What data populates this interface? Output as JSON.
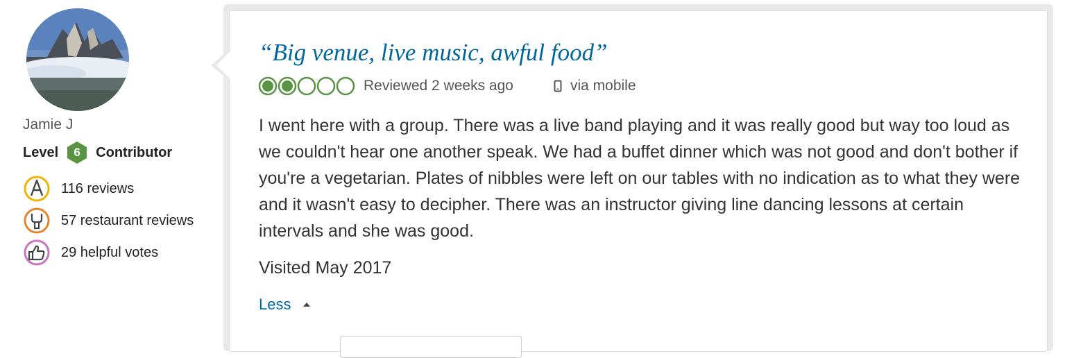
{
  "reviewer": {
    "name": "Jamie J",
    "level_prefix": "Level",
    "level_number": "6",
    "level_suffix": "Contributor",
    "stats": {
      "reviews": "116 reviews",
      "restaurant_reviews": "57 restaurant reviews",
      "helpful_votes": "29 helpful votes"
    },
    "icons": {
      "reviews": "pen-badge-icon",
      "restaurant_reviews": "fork-knife-icon",
      "helpful_votes": "thumbs-up-icon"
    }
  },
  "review": {
    "title": "“Big venue, live music, awful food”",
    "rating": 2,
    "rating_max": 5,
    "reviewed_text": "Reviewed 2 weeks ago",
    "via_text": "via mobile",
    "body": "I went here with a group. There was a live band playing and it was really good but way too loud as we couldn't hear one another speak. We had a buffet dinner which was not good and don't bother if you're a vegetarian. Plates of nibbles were left on our tables with no indication as to what they were and it wasn't easy to decipher. There was an instructor giving line dancing lessons at certain intervals and she was good.",
    "visited": "Visited May 2017",
    "less_label": "Less"
  },
  "colors": {
    "link": "#00679e",
    "rating_green": "#589442",
    "level_badge": "#589442",
    "reviews_icon": "#f2b203",
    "restaurant_icon": "#e8842c",
    "helpful_icon": "#c874c2"
  }
}
